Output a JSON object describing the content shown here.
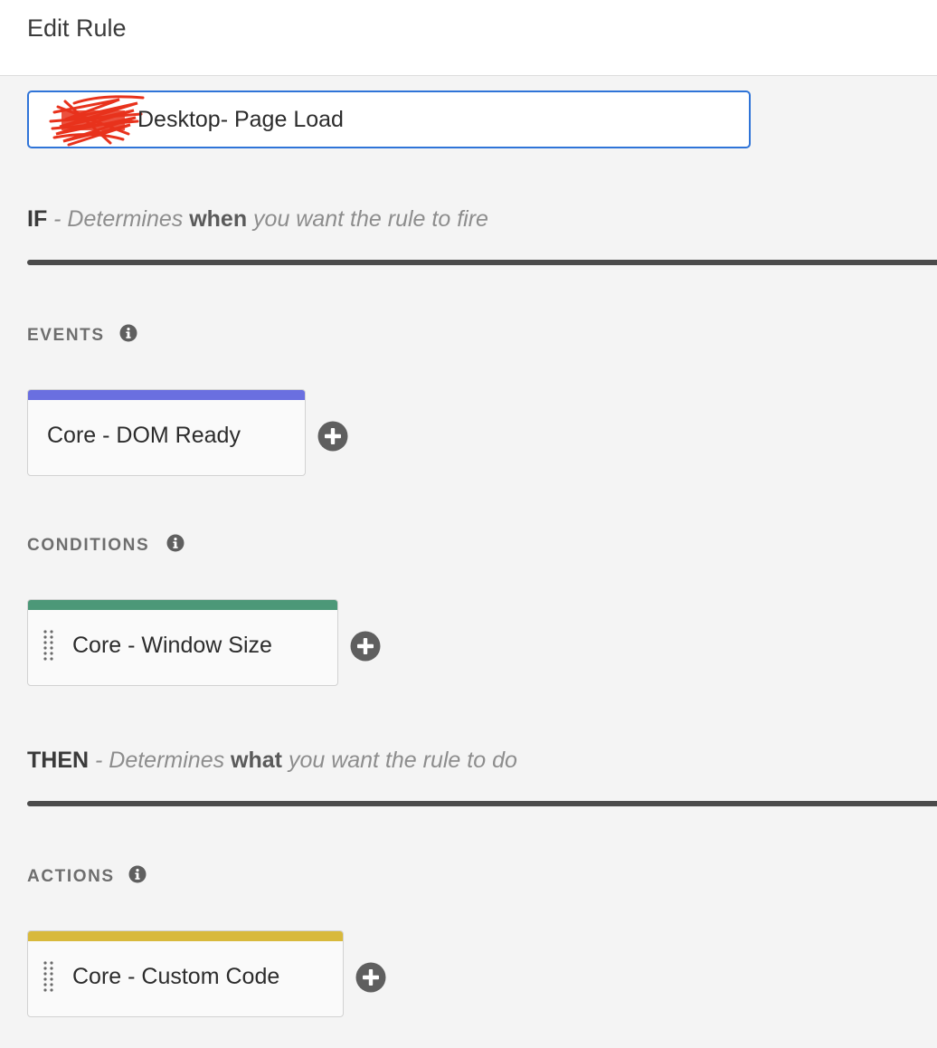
{
  "header": {
    "title": "Edit Rule"
  },
  "rule_name": {
    "value": "Desktop- Page Load"
  },
  "if_section": {
    "keyword": "IF",
    "desc_prefix": " - Determines ",
    "desc_emphasis": "when",
    "desc_suffix": " you want the rule to fire"
  },
  "events": {
    "label": "EVENTS",
    "items": [
      {
        "label": "Core - DOM Ready",
        "accent": "#6a6fe0"
      }
    ]
  },
  "conditions": {
    "label": "CONDITIONS",
    "items": [
      {
        "label": "Core - Window Size",
        "accent": "#4c9878"
      }
    ]
  },
  "then_section": {
    "keyword": "THEN",
    "desc_prefix": " - Determines ",
    "desc_emphasis": "what",
    "desc_suffix": " you want the rule to do"
  },
  "actions": {
    "label": "ACTIONS",
    "items": [
      {
        "label": "Core - Custom Code",
        "accent": "#d8b93c"
      }
    ]
  },
  "colors": {
    "focus_border": "#2f74d8",
    "divider": "#4b4b4b",
    "icon": "#5f5f5f",
    "redaction": "#e8321c"
  },
  "icons": {
    "info": "info-icon",
    "add": "plus-circle-icon",
    "drag": "drag-handle-icon"
  }
}
